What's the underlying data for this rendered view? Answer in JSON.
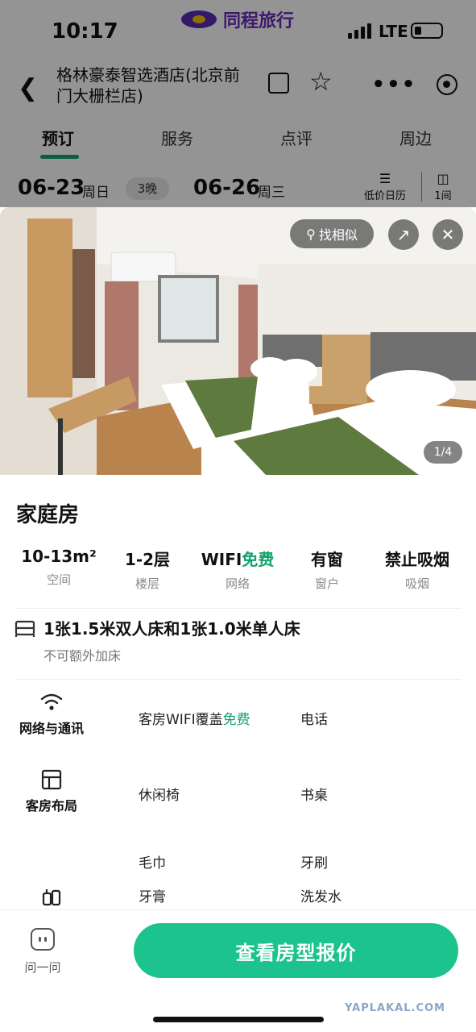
{
  "status_bar": {
    "time": "10:17",
    "network": "LTE"
  },
  "brand": {
    "name": "同程旅行"
  },
  "header": {
    "hotel_name": "格林豪泰智选酒店(北京前门大栅栏店)"
  },
  "tabs": [
    {
      "label": "预订",
      "active": true
    },
    {
      "label": "服务",
      "active": false
    },
    {
      "label": "点评",
      "active": false
    },
    {
      "label": "周边",
      "active": false
    }
  ],
  "stay": {
    "check_in": "06-23",
    "check_in_day": "周日",
    "nights": "3晚",
    "check_out": "06-26",
    "check_out_day": "周三",
    "calendar_label": "低价日历",
    "rooms_label": "1间"
  },
  "photo": {
    "search_similar_label": "找相似",
    "counter": "1/4"
  },
  "room": {
    "name": "家庭房",
    "facts": [
      {
        "value": "10-13m²",
        "label": "空间"
      },
      {
        "value": "1-2层",
        "label": "楼层"
      },
      {
        "value": "WIFI",
        "value_green": "免费",
        "label": "网络"
      },
      {
        "value": "有窗",
        "label": "窗户"
      },
      {
        "value": "禁止吸烟",
        "label": "吸烟"
      }
    ],
    "bed": "1张1.5米双人床和1张1.0米单人床",
    "bed_note": "不可额外加床"
  },
  "amenities": {
    "network": {
      "label": "网络与通讯",
      "items": [
        {
          "text": "客房WIFI覆盖",
          "text_green": "免费"
        },
        {
          "text": "电话"
        }
      ]
    },
    "layout": {
      "label": "客房布局",
      "items": [
        {
          "text": "休闲椅"
        },
        {
          "text": "书桌"
        }
      ]
    },
    "toiletries": {
      "items": [
        {
          "text": "毛巾"
        },
        {
          "text": "牙刷"
        },
        {
          "text": "牙膏"
        },
        {
          "text": "洗发水"
        }
      ]
    }
  },
  "bottom_bar": {
    "ask_label": "问一问",
    "cta_label": "查看房型报价"
  },
  "watermark": "YAPLAKAL.COM",
  "colors": {
    "accent_green": "#12a36b",
    "cta_green": "#1cc38c",
    "brand_purple": "#6a2bbf"
  }
}
